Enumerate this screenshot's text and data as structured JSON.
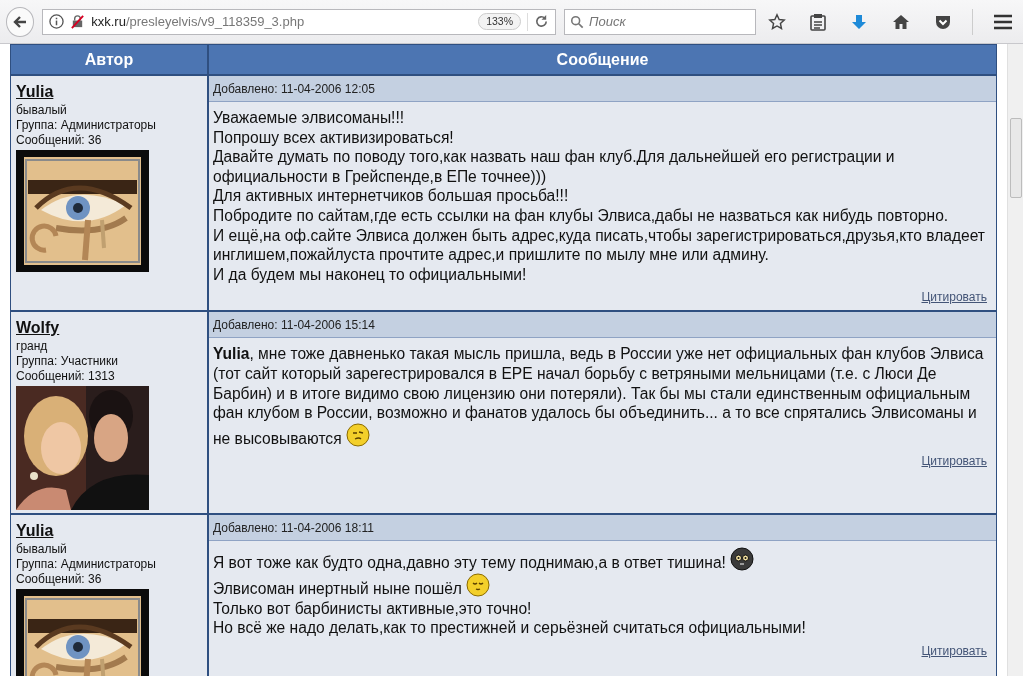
{
  "browser": {
    "url_host": "kxk.ru",
    "url_path": "/presleyelvis/v9_118359_3.php",
    "zoom": "133%",
    "search": {
      "placeholder": "Поиск"
    }
  },
  "table": {
    "columns": [
      "Автор",
      "Сообщение"
    ],
    "posts": [
      {
        "author": "Yulia",
        "rank": "бывалый",
        "group": "Группа: Администраторы",
        "count": "Сообщений: 36",
        "date": "Добавлено: 11-04-2006 12:05",
        "quote": "Цитировать",
        "lines": [
          {
            "text": "Уважаемые элвисоманы!!!",
            "emoticon": false
          },
          {
            "text": "Попрошу всех активизироваться!",
            "emoticon": false
          },
          {
            "text": "Давайте думать по поводу того,как назвать наш фан клуб.Для дальнейшей его регистрации и",
            "emoticon": false
          },
          {
            "text": "официальности в Грейспенде,в ЕПе точнее)))",
            "emoticon": false
          },
          {
            "text": "Для активных интернетчиков большая просьба!!!",
            "emoticon": false
          },
          {
            "text": "Побродите по сайтам,где есть ссылки на фан клубы Элвиса,дабы не назваться как нибудь повторно.",
            "emoticon": false
          },
          {
            "text": "И ещё,на оф.сайте Элвиса должен быть адрес,куда писать,чтобы зарегистрироваться,друзья,кто владеет",
            "emoticon": false
          },
          {
            "text": "инглишем,пожайлуста прочтите адрес,и пришлите по мылу мне или админу.",
            "emoticon": false
          },
          {
            "text": "И да будем мы наконец то официальными!",
            "emoticon": false
          }
        ]
      },
      {
        "author": "Wolfy",
        "rank": "гранд",
        "group": "Группа: Участники",
        "count": "Сообщений: 1313",
        "date": "Добавлено: 11-04-2006 15:14",
        "quote": "Цитировать",
        "lines": [
          {
            "text": "**Yulia**, мне тоже давненько такая мысль пришла, ведь в России уже нет официальных фан клубов Элвиса",
            "emoticon": false
          },
          {
            "text": "(тот сайт который зарегестрировался в ЕРЕ начал борьбу с ветряными мельницами (т.е. с Люси Де",
            "emoticon": false
          },
          {
            "text": "Барбин) и в итоге видимо свою лицензию они потеряли). Так бы мы стали единственным официальным",
            "emoticon": false
          },
          {
            "text": "фан клубом в России, возможно и фанатов удалось бы объединить... а то все спрятались Элвисоманы и",
            "emoticon": false
          },
          {
            "text": "не высовываются",
            "emoticon": true
          }
        ]
      },
      {
        "author": "Yulia",
        "rank": "бывалый",
        "group": "Группа: Администраторы",
        "count": "Сообщений: 36",
        "date": "Добавлено: 11-04-2006 18:11",
        "quote": "Цитировать",
        "lines": [
          {
            "text": "Я вот тоже как будто одна,давно эту тему поднимаю,а в ответ тишина!",
            "emoticon": true
          },
          {
            "text": "Элвисоман инертный ныне пошёл",
            "emoticon": true
          },
          {
            "text": "Только вот барбинисты активные,это точно!",
            "emoticon": false
          },
          {
            "text": "Но всё же надо делать,как то престижней и серьёзней считаться официальными!",
            "emoticon": false
          }
        ]
      }
    ]
  }
}
